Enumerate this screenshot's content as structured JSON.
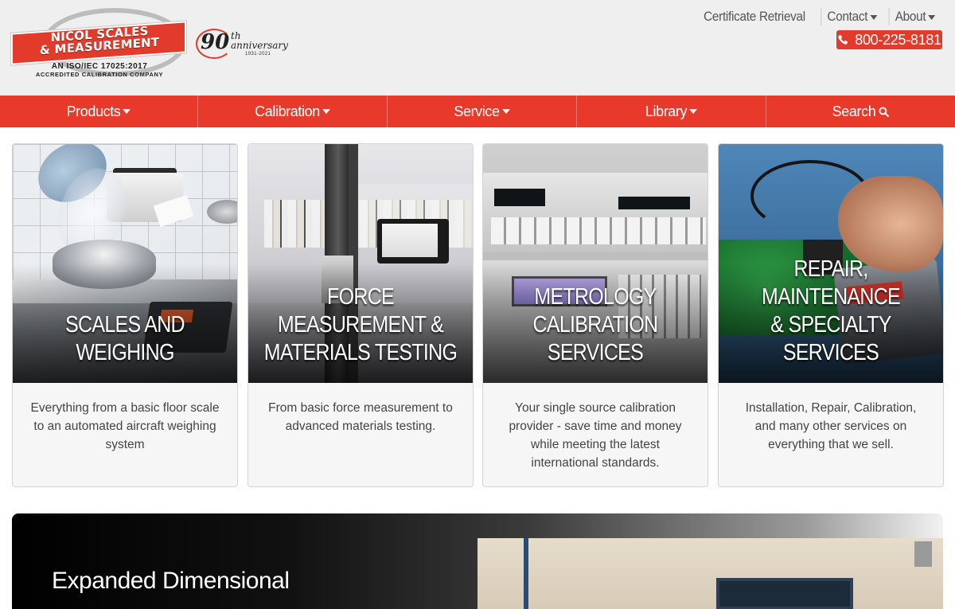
{
  "header": {
    "logo": {
      "name_line1": "NICOL SCALES",
      "name_line2": "& MEASUREMENT",
      "tagline1": "AN ISO/IEC 17025:2017",
      "tagline2": "ACCREDITED CALIBRATION COMPANY"
    },
    "anniversary": {
      "number": "90",
      "suffix": "th",
      "word": "anniversary",
      "years": "1931-2021"
    },
    "top_links": [
      {
        "label": "Certificate Retrieval"
      },
      {
        "label": "Contact"
      },
      {
        "label": "About"
      }
    ],
    "phone": "800-225-8181"
  },
  "main_nav": [
    {
      "label": "Products"
    },
    {
      "label": "Calibration"
    },
    {
      "label": "Service"
    },
    {
      "label": "Library"
    },
    {
      "label": "Search"
    }
  ],
  "cards": [
    {
      "title_line1": "",
      "title_line2": "SCALES AND WEIGHING",
      "description": "Everything from a basic floor scale to an automated aircraft weighing system"
    },
    {
      "title_line1": "FORCE MEASUREMENT &",
      "title_line2": "MATERIALS TESTING",
      "description": "From basic force measurement to advanced materials testing."
    },
    {
      "title_line1": "METROLOGY",
      "title_line2": "CALIBRATION SERVICES",
      "description": "Your single source calibration provider - save time and money while meeting the latest international standards."
    },
    {
      "title_line1": "REPAIR, MAINTENANCE",
      "title_line2": "& SPECIALTY SERVICES",
      "description": "Installation, Repair, Calibration, and many other services on everything that we sell."
    }
  ],
  "banner": {
    "title": "Expanded Dimensional"
  },
  "colors": {
    "brand_red": "#e8392a",
    "header_bg": "#efefef"
  }
}
